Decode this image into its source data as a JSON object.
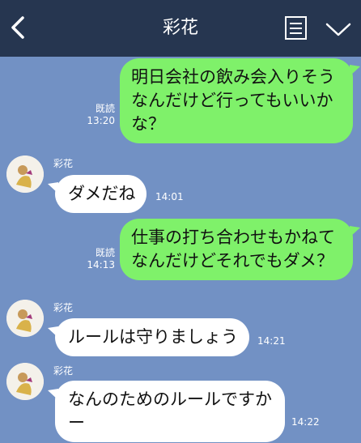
{
  "header": {
    "title": "彩花",
    "back_icon": "chevron-left-icon",
    "menu_icon": "list-icon",
    "expand_icon": "chevron-down-icon"
  },
  "messages": [
    {
      "direction": "out",
      "text": "明日会社の飲み会入りそうなんだけど行ってもいいかな？",
      "read": "既読",
      "time": "13:20"
    },
    {
      "direction": "in",
      "sender": "彩花",
      "text": "ダメだね",
      "time": "14:01"
    },
    {
      "direction": "out",
      "text": "仕事の打ち合わせもかねてなんだけどそれでもダメ？",
      "read": "既読",
      "time": "14:13"
    },
    {
      "direction": "in",
      "sender": "彩花",
      "text": "ルールは守りましょう",
      "time": "14:21"
    },
    {
      "direction": "in",
      "sender": "彩花",
      "text": "なんのためのルールですかー",
      "time": "14:22"
    }
  ],
  "colors": {
    "header_bg": "#263650",
    "chat_bg": "#7291c4",
    "outgoing_bubble": "#7ff16a",
    "incoming_bubble": "#ffffff"
  }
}
